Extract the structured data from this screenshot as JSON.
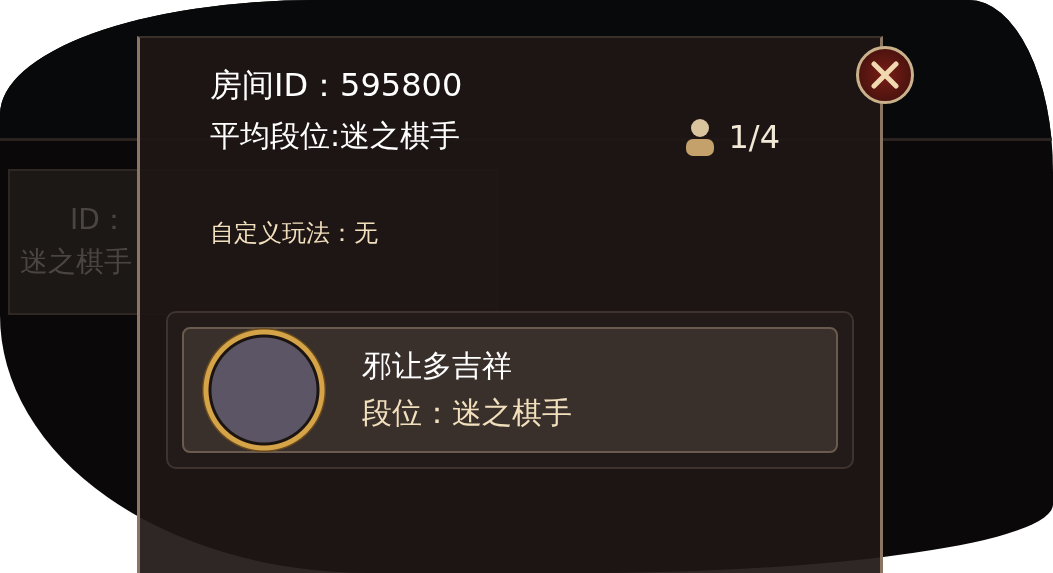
{
  "background": {
    "room_card": {
      "id_label": "ID：",
      "info": "迷之棋手"
    }
  },
  "dialog": {
    "room_id": "房间ID：595800",
    "average_rank": "平均段位:迷之棋手",
    "players_count": "1/4",
    "custom_rules": "自定义玩法：无",
    "players": [
      {
        "name": "邪让多吉祥",
        "rank": "段位：迷之棋手"
      }
    ]
  }
}
